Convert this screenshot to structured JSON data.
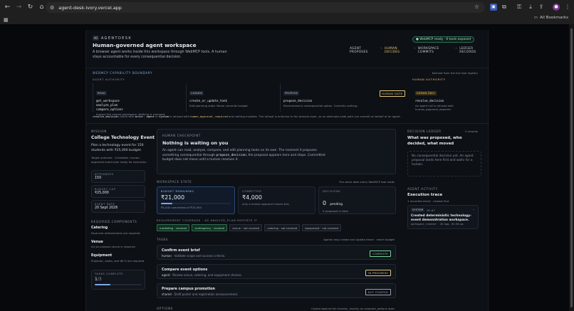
{
  "browser": {
    "url": "agent-desk-ivory.vercel.app",
    "bookmarks_label": "All Bookmarks"
  },
  "header": {
    "logo_mark": "AD",
    "brand": "AGENTDESK",
    "title": "Human-governed agent workspace",
    "subtitle": "A browser agent works inside this workspace through WebMCP tools. A human stays accountable for every consequential decision.",
    "status_pill": "● WebMCP ready · 6 tools exposed",
    "nav": [
      "AGENT PROPOSES",
      "HUMAN DECIDES",
      "WORKSPACE COMMITS",
      "LEDGER RECORDS"
    ],
    "nav_sep": "→"
  },
  "capability": {
    "heading": "WEBMCP CAPABILITY BOUNDARY",
    "derived_note": "Derived from the live tool registry",
    "agent_authority": "AGENT AUTHORITY",
    "human_authority": "HUMAN AUTHORITY",
    "groups": [
      {
        "tag": "READ",
        "tools": [
          "get_workspace",
          "analyze_plan",
          "compare_options"
        ],
        "desc": "Inspect the shared workspace. Nothing is changed."
      },
      {
        "tag": "CHANGE",
        "tools": [
          "create_or_update_task"
        ],
        "desc": "Edit planning state. Never commits budget."
      },
      {
        "tag": "PROPOSE",
        "tools": [
          "propose_decision"
        ],
        "desc": "Recommend a consequential option. Commits nothing."
      }
    ],
    "gate_label": "HUMAN GATE",
    "human_group": {
      "tag": "HUMAN ONLY",
      "tools": [
        "resolve_decision"
      ],
      "desc": "An agent call is refused with human_approval_required."
    },
    "footnote_parts": [
      "resolve_decision",
      " called with ",
      "actor: agent",
      " or ",
      "system",
      " is refused with ",
      "human_approval_required",
      " and nothing mutates. The refusal is enforced in the domain layer, so no alternate code path can commit on behalf of an agent."
    ]
  },
  "mission": {
    "label": "MISSION",
    "title": "College Technology Event",
    "desc": "Plan a technology event for 150 students with ₹25,000 budget.",
    "target": "Target outcome · A feasible, human-approved event plan ready for execution.",
    "stats": [
      {
        "label": "ATTENDEES",
        "value": "150"
      },
      {
        "label": "BUDGET CAP",
        "value": "₹25,000"
      },
      {
        "label": "EVENT DATE",
        "value": "20 Sept 2026"
      }
    ],
    "req_label": "REQUIRED COMPONENTS",
    "components": [
      {
        "name": "Catering",
        "desc": "Food and refreshments are required."
      },
      {
        "name": "Venue",
        "desc": "An on-campus venue is required."
      },
      {
        "name": "Equipment",
        "desc": "Projector, audio, and Wi-Fi are required."
      }
    ],
    "tasks_complete_label": "TASKS COMPLETE",
    "tasks_done": "1",
    "tasks_total": "/3",
    "tasks_fraction": 0.333
  },
  "checkpoint": {
    "label": "HUMAN CHECKPOINT",
    "title": "Nothing is waiting on you",
    "desc_parts": [
      "An agent can read, analyze, compare, and edit planning tasks on its own. The moment it proposes something consequential through ",
      "propose_decision",
      ", the proposal appears here and stops. Committed budget does not move until a human resolves it."
    ]
  },
  "stats": {
    "label": "WORKSPACE STATE",
    "note": "The same data every WebMCP tool reads",
    "budget_label": "BUDGET REMAINING",
    "budget_value": "₹21,000",
    "budget_fraction": 0.16,
    "budget_sub": "₹4,000 committed of ₹25,000",
    "committed_label": "COMMITTED",
    "committed_value": "₹4,000",
    "committed_sub": "only a human approval moves this",
    "decisions_label": "DECISIONS",
    "decisions_value": "0",
    "decisions_word": "pending",
    "decisions_sub": "0 proposed in total"
  },
  "coverage": {
    "label": "REQUIREMENT COVERAGE · AS ANALYZE_PLAN REPORTS IT",
    "items": [
      {
        "text": "marketing · covered",
        "covered": true
      },
      {
        "text": "contingency · covered",
        "covered": true
      },
      {
        "text": "venue · not covered",
        "covered": false
      },
      {
        "text": "catering · not covered",
        "covered": false
      },
      {
        "text": "equipment · not covered",
        "covered": false
      }
    ]
  },
  "tasks": {
    "label": "TASKS",
    "note": "Agents may create and update these · never budget",
    "items": [
      {
        "title": "Confirm event brief",
        "owner": "human",
        "desc": " · Validate scope and success criteria.",
        "status": "COMPLETE",
        "status_color": "#7ad1a0"
      },
      {
        "title": "Compare event options",
        "owner": "agent",
        "desc": " · Review venue, catering, and equipment choices.",
        "status": "IN PROGRESS",
        "status_color": "#e3c47a"
      },
      {
        "title": "Prepare campus promotion",
        "owner": "shared",
        "desc": " · Draft poster and registration announcement.",
        "status": "NOT STARTED",
        "status_color": "#9aa3b2"
      }
    ]
  },
  "options": {
    "label": "OPTIONS",
    "note": "Costed against the mission, exactly as compare_options does"
  },
  "ledger": {
    "label": "DECISION LEDGER",
    "count": "0 records",
    "title": "What was proposed, who decided, what moved",
    "empty": "No consequential decision yet. An agent proposal lands here first and waits for a human."
  },
  "activity": {
    "label": "AGENT ACTIVITY",
    "title": "Execution trace",
    "sub": "1 recorded event · newest first",
    "event_actor": "SYSTEM",
    "event_time": "02:07",
    "event_title": "Created deterministic technology-event demonstration workspace.",
    "event_sub": "workspace_created · 20 Aug, 02:36 pm"
  },
  "colors": {
    "accent": "#e3c47a",
    "green": "#7ad1a0",
    "blue": "#7aa8e8"
  }
}
